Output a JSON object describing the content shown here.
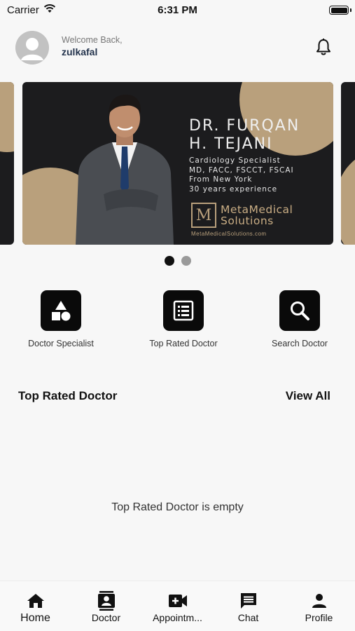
{
  "status_bar": {
    "carrier": "Carrier",
    "time": "6:31 PM"
  },
  "header": {
    "welcome": "Welcome Back,",
    "username": "zulkafal"
  },
  "banner": {
    "name_line1": "DR. FURQAN",
    "name_line2": "H. TEJANI",
    "specialty": "Cardiology Specialist",
    "credentials": "MD, FACC, FSCCT, FSCAI",
    "location": "From New York",
    "experience": "30 years experience",
    "brand_line1": "MetaMedical",
    "brand_line2": "Solutions",
    "brand_url": "MetaMedicalSolutions.com",
    "accent_color": "#b9a07c"
  },
  "carousel": {
    "active_index": 0,
    "count": 2
  },
  "quick_actions": [
    {
      "label": "Doctor Specialist",
      "icon": "shapes-icon"
    },
    {
      "label": "Top Rated Doctor",
      "icon": "list-icon"
    },
    {
      "label": "Search Doctor",
      "icon": "search-icon"
    }
  ],
  "section": {
    "title": "Top Rated Doctor",
    "view_all": "View All",
    "empty_message": "Top Rated Doctor is empty"
  },
  "tabs": [
    {
      "label": "Home",
      "icon": "home-icon",
      "active": true
    },
    {
      "label": "Doctor",
      "icon": "contact-card-icon"
    },
    {
      "label": "Appointm...",
      "icon": "video-camera-icon"
    },
    {
      "label": "Chat",
      "icon": "chat-icon"
    },
    {
      "label": "Profile",
      "icon": "person-icon"
    }
  ]
}
